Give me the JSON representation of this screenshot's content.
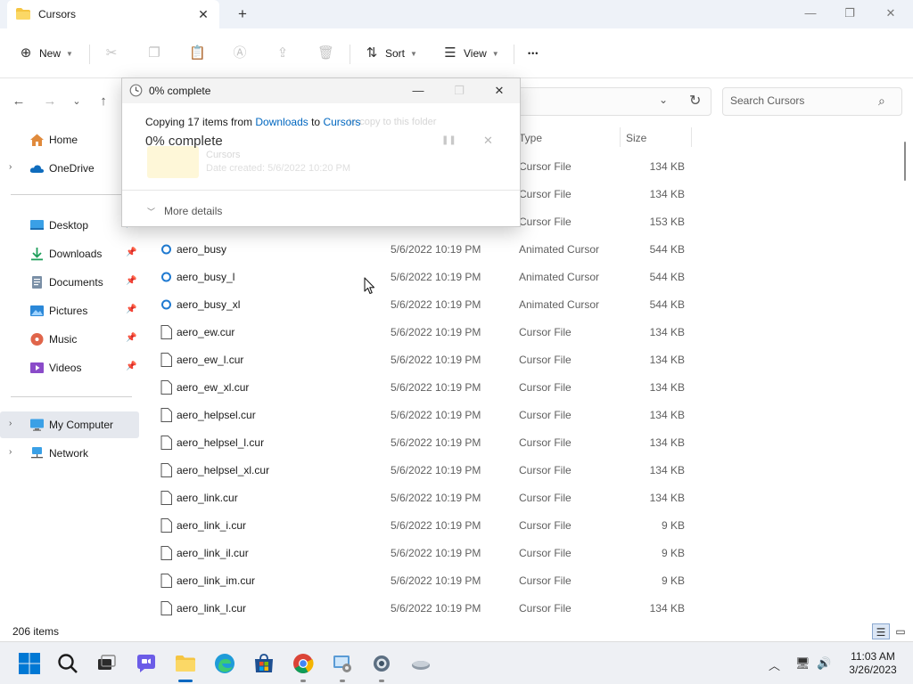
{
  "window": {
    "tab_title": "Cursors",
    "new_tab_glyph": "+",
    "close_glyph": "✕",
    "minimize_glyph": "—",
    "maximize_glyph": "❐"
  },
  "toolbar": {
    "new_label": "New",
    "sort_label": "Sort",
    "view_label": "View",
    "more_glyph": "•••"
  },
  "search": {
    "placeholder": "Search Cursors"
  },
  "sidebar": {
    "items": [
      {
        "label": "Home"
      },
      {
        "label": "OneDrive"
      },
      {
        "label": "Desktop"
      },
      {
        "label": "Downloads"
      },
      {
        "label": "Documents"
      },
      {
        "label": "Pictures"
      },
      {
        "label": "Music"
      },
      {
        "label": "Videos"
      },
      {
        "label": "My Computer"
      },
      {
        "label": "Network"
      }
    ]
  },
  "list": {
    "headers": {
      "type": "Type",
      "size": "Size"
    },
    "rows": [
      {
        "name": "",
        "date": "",
        "type": "Cursor File",
        "size": "134 KB"
      },
      {
        "name": "",
        "date": "",
        "type": "Cursor File",
        "size": "134 KB"
      },
      {
        "name": "",
        "date": "",
        "type": "Cursor File",
        "size": "153 KB"
      },
      {
        "name": "aero_busy",
        "date": "5/6/2022 10:19 PM",
        "type": "Animated Cursor",
        "size": "544 KB"
      },
      {
        "name": "aero_busy_l",
        "date": "5/6/2022 10:19 PM",
        "type": "Animated Cursor",
        "size": "544 KB"
      },
      {
        "name": "aero_busy_xl",
        "date": "5/6/2022 10:19 PM",
        "type": "Animated Cursor",
        "size": "544 KB"
      },
      {
        "name": "aero_ew.cur",
        "date": "5/6/2022 10:19 PM",
        "type": "Cursor File",
        "size": "134 KB"
      },
      {
        "name": "aero_ew_l.cur",
        "date": "5/6/2022 10:19 PM",
        "type": "Cursor File",
        "size": "134 KB"
      },
      {
        "name": "aero_ew_xl.cur",
        "date": "5/6/2022 10:19 PM",
        "type": "Cursor File",
        "size": "134 KB"
      },
      {
        "name": "aero_helpsel.cur",
        "date": "5/6/2022 10:19 PM",
        "type": "Cursor File",
        "size": "134 KB"
      },
      {
        "name": "aero_helpsel_l.cur",
        "date": "5/6/2022 10:19 PM",
        "type": "Cursor File",
        "size": "134 KB"
      },
      {
        "name": "aero_helpsel_xl.cur",
        "date": "5/6/2022 10:19 PM",
        "type": "Cursor File",
        "size": "134 KB"
      },
      {
        "name": "aero_link.cur",
        "date": "5/6/2022 10:19 PM",
        "type": "Cursor File",
        "size": "134 KB"
      },
      {
        "name": "aero_link_i.cur",
        "date": "5/6/2022 10:19 PM",
        "type": "Cursor File",
        "size": "9 KB"
      },
      {
        "name": "aero_link_il.cur",
        "date": "5/6/2022 10:19 PM",
        "type": "Cursor File",
        "size": "9 KB"
      },
      {
        "name": "aero_link_im.cur",
        "date": "5/6/2022 10:19 PM",
        "type": "Cursor File",
        "size": "9 KB"
      },
      {
        "name": "aero_link_l.cur",
        "date": "5/6/2022 10:19 PM",
        "type": "Cursor File",
        "size": "134 KB"
      }
    ]
  },
  "status": {
    "item_count": "206 items"
  },
  "dialog": {
    "title": "0% complete",
    "copying_prefix": "Copying 17 items from ",
    "source": "Downloads",
    "to_word": " to ",
    "destination": "Cursors",
    "percent": "0% complete",
    "more_details": "More details",
    "ghost_note": "to copy to this folder",
    "ghost_name": "Cursors",
    "ghost_date": "Date created: 5/6/2022 10:20 PM"
  },
  "clock": {
    "time": "11:03 AM",
    "date": "3/26/2023"
  },
  "colors": {
    "accent": "#0067c0",
    "folder": "#f5c542",
    "taskbar": "#eef0f4"
  }
}
